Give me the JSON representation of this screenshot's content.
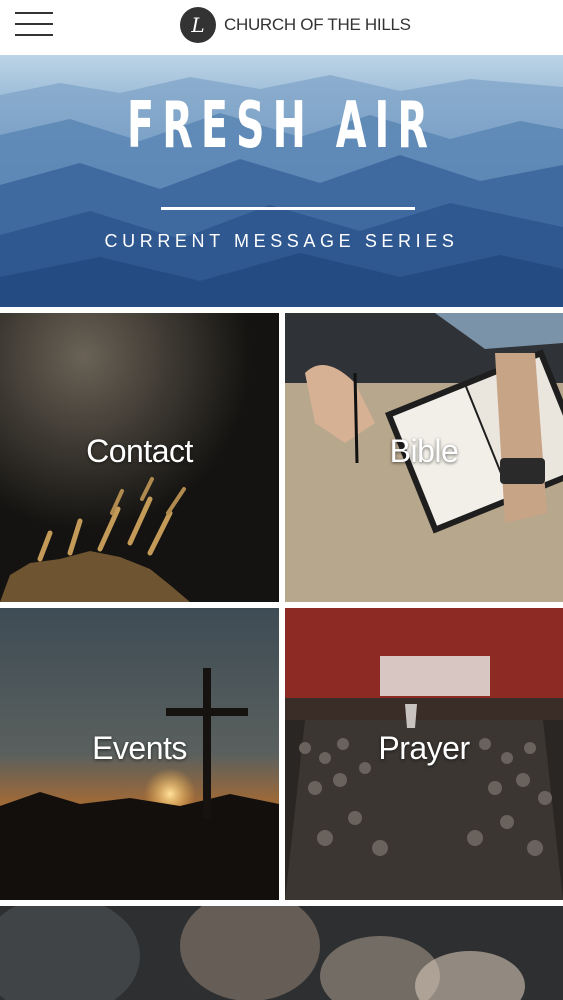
{
  "header": {
    "menu_icon": "hamburger-menu-icon",
    "logo_icon": "church-logo-icon",
    "logo_glyph": "L",
    "brand": "CHURCH OF THE HILLS"
  },
  "hero": {
    "title": "FRESH AIR",
    "subtitle": "CURRENT MESSAGE SERIES"
  },
  "tiles": [
    {
      "label": "Contact"
    },
    {
      "label": "Bible"
    },
    {
      "label": "Events"
    },
    {
      "label": "Prayer"
    }
  ],
  "colors": {
    "text_dark": "#333333",
    "hero_blue": "#3e6aa3",
    "tile_text": "#ffffff"
  }
}
